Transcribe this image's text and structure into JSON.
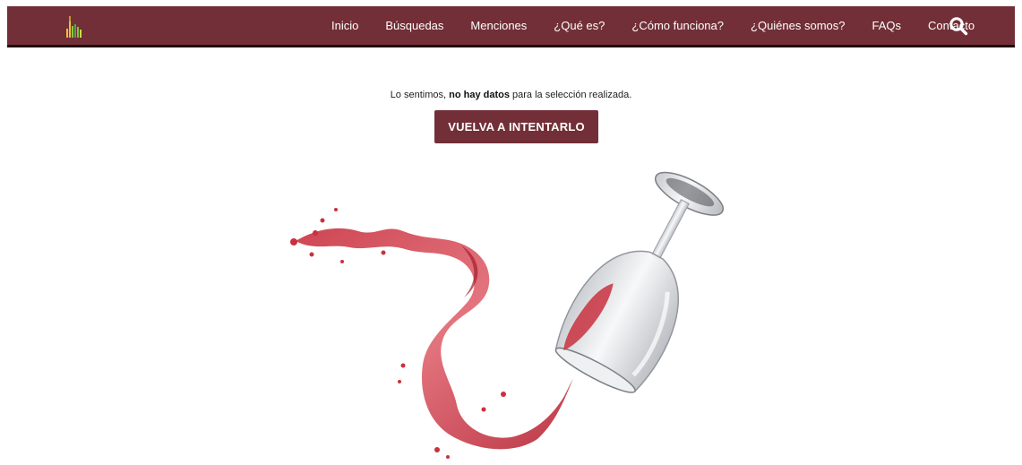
{
  "nav": {
    "items": [
      {
        "label": "Inicio"
      },
      {
        "label": "Búsquedas"
      },
      {
        "label": "Menciones"
      },
      {
        "label": "¿Qué es?"
      },
      {
        "label": "¿Cómo funciona?"
      },
      {
        "label": "¿Quiénes somos?"
      },
      {
        "label": "FAQs"
      },
      {
        "label": "Contacto"
      }
    ],
    "search_icon": "search-icon",
    "logo_icon": "bottles-chart-logo"
  },
  "message": {
    "prefix": "Lo sentimos, ",
    "emphasis": "no hay datos",
    "suffix": " para la selección realizada."
  },
  "retry_button": {
    "label": "VUELVA A INTENTARLO"
  },
  "illustration": {
    "icon": "spilling-wine-glass-image"
  },
  "colors": {
    "brand": "#722f37",
    "nav_border": "#1e0f10",
    "wine": "#c8313f",
    "background": "#ffffff"
  }
}
